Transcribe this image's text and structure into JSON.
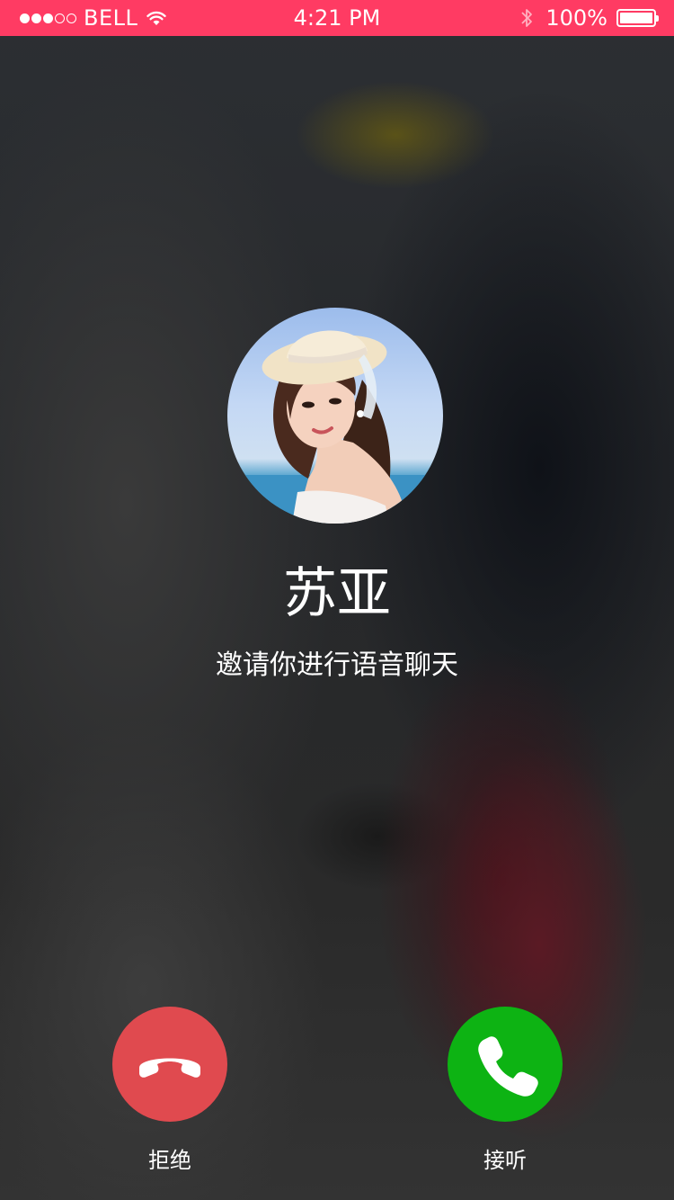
{
  "status_bar": {
    "signal_bars_filled": 3,
    "signal_bars_total": 5,
    "carrier": "BELL",
    "time": "4:21 PM",
    "battery_percent": "100%",
    "battery_level": 1.0,
    "color": "#ff3b63"
  },
  "caller": {
    "name": "苏亚",
    "description": "邀请你进行语音聊天"
  },
  "actions": {
    "decline": {
      "label": "拒绝",
      "color": "#e04a4f",
      "icon": "phone-hangup-icon"
    },
    "accept": {
      "label": "接听",
      "color": "#0db313",
      "icon": "phone-icon"
    }
  }
}
